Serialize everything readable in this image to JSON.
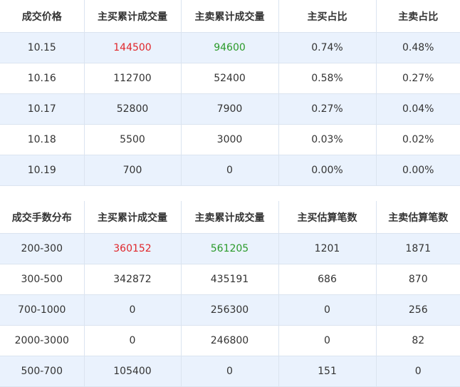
{
  "price_table": {
    "headers": [
      "成交价格",
      "主买累计成交量",
      "主卖累计成交量",
      "主买占比",
      "主卖占比"
    ],
    "rows": [
      [
        "10.15",
        "144500",
        "94600",
        "0.74%",
        "0.48%"
      ],
      [
        "10.16",
        "112700",
        "52400",
        "0.58%",
        "0.27%"
      ],
      [
        "10.17",
        "52800",
        "7900",
        "0.27%",
        "0.04%"
      ],
      [
        "10.18",
        "5500",
        "3000",
        "0.03%",
        "0.02%"
      ],
      [
        "10.19",
        "700",
        "0",
        "0.00%",
        "0.00%"
      ]
    ]
  },
  "lot_table": {
    "headers": [
      "成交手数分布",
      "主买累计成交量",
      "主卖累计成交量",
      "主买估算笔数",
      "主卖估算笔数"
    ],
    "rows": [
      [
        "200-300",
        "360152",
        "561205",
        "1201",
        "1871"
      ],
      [
        "300-500",
        "342872",
        "435191",
        "686",
        "870"
      ],
      [
        "700-1000",
        "0",
        "256300",
        "0",
        "256"
      ],
      [
        "2000-3000",
        "0",
        "246800",
        "0",
        "82"
      ],
      [
        "500-700",
        "105400",
        "0",
        "151",
        "0"
      ]
    ]
  },
  "colors": {
    "buy_highlight": "#e0262b",
    "sell_highlight": "#2a9a2a",
    "row_shade": "#eaf2fd",
    "grid_line": "#dbe4f0"
  }
}
